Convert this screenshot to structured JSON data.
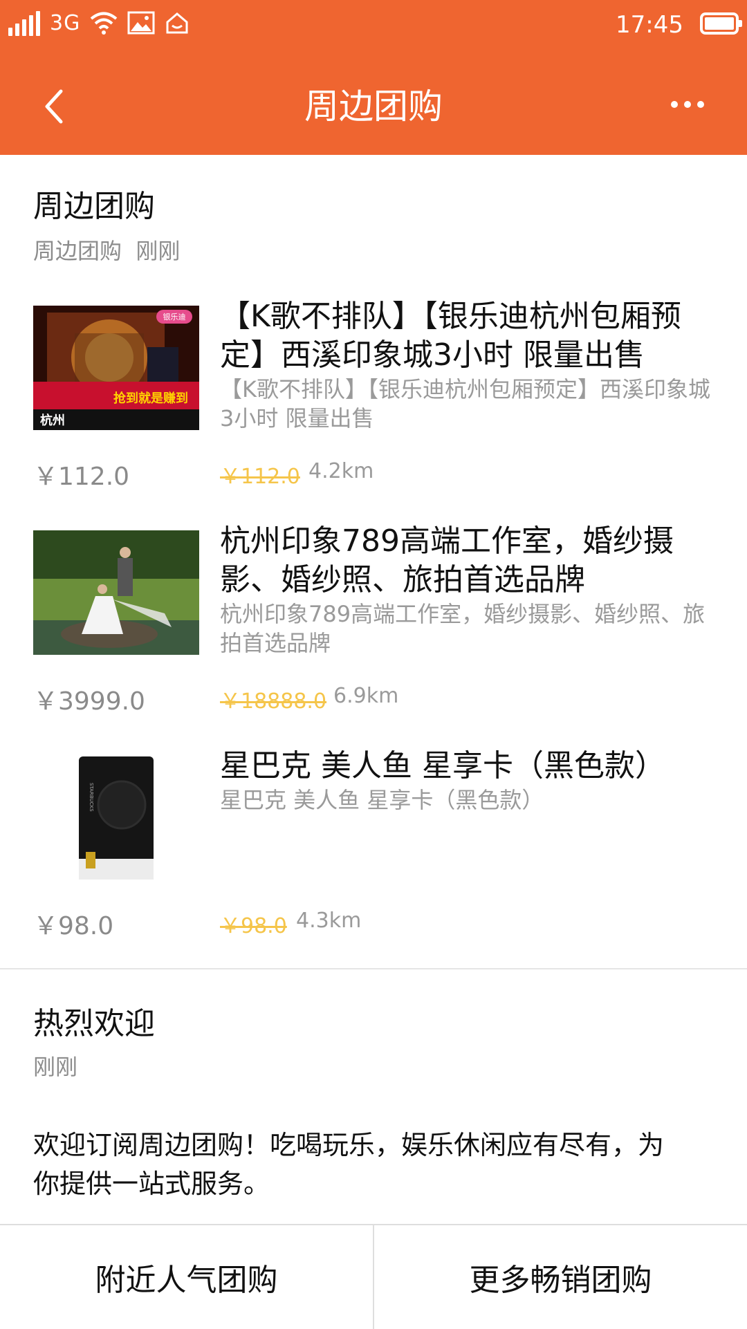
{
  "status_bar": {
    "network": "3G",
    "time": "17:45"
  },
  "nav": {
    "title": "周边团购"
  },
  "colors": {
    "brand": "#ef6530",
    "strike_price": "#f5c54a"
  },
  "card1": {
    "title": "周边团购",
    "source": "周边团购",
    "time": "刚刚",
    "items": [
      {
        "title": "【K歌不排队】【银乐迪杭州包厢预定】西溪印象城3小时 限量出售",
        "desc": "【K歌不排队】【银乐迪杭州包厢预定】西溪印象城3小时 限量出售",
        "price": "￥112.0",
        "original_price": "￥112.0",
        "distance": "4.2km",
        "thumb_text": {
          "badge": "银乐迪",
          "banner": "抢到就是赚到",
          "city": "杭州"
        }
      },
      {
        "title": "杭州印象789高端工作室，婚纱摄影、婚纱照、旅拍首选品牌",
        "desc": "杭州印象789高端工作室，婚纱摄影、婚纱照、旅拍首选品牌",
        "price": "￥3999.0",
        "original_price": "￥18888.0",
        "distance": "6.9km"
      },
      {
        "title": "星巴克 美人鱼 星享卡（黑色款）",
        "desc": "星巴克 美人鱼 星享卡（黑色款）",
        "price": "￥98.0",
        "original_price": "￥98.0",
        "distance": "4.3km"
      }
    ]
  },
  "card2": {
    "title": "热烈欢迎",
    "time": "刚刚",
    "body": "欢迎订阅周边团购！吃喝玩乐，娱乐休闲应有尽有，为你提供一站式服务。"
  },
  "bottom_menu": {
    "left": "附近人气团购",
    "right": "更多畅销团购"
  }
}
